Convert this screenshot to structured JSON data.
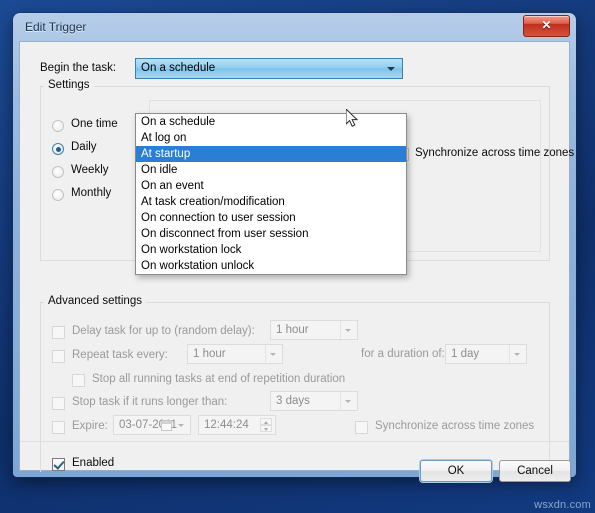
{
  "window": {
    "title": "Edit Trigger",
    "close_label": "✕"
  },
  "form": {
    "begin_label": "Begin the task:",
    "begin_value": "On a schedule"
  },
  "dropdown": {
    "selected": "At startup",
    "items": [
      "On a schedule",
      "At log on",
      "At startup",
      "On idle",
      "On an event",
      "At task creation/modification",
      "On connection to user session",
      "On disconnect from user session",
      "On workstation lock",
      "On workstation unlock"
    ]
  },
  "settings": {
    "legend": "Settings",
    "radios": [
      {
        "label": "One time",
        "checked": false
      },
      {
        "label": "Daily",
        "checked": true
      },
      {
        "label": "Weekly",
        "checked": false
      },
      {
        "label": "Monthly",
        "checked": false
      }
    ],
    "sync_label": "Synchronize across time zones",
    "sync_checked": false
  },
  "advanced": {
    "legend": "Advanced settings",
    "delay_label": "Delay task for up to (random delay):",
    "delay_checked": false,
    "delay_value": "1 hour",
    "repeat_label": "Repeat task every:",
    "repeat_checked": false,
    "repeat_value": "1 hour",
    "duration_label": "for a duration of:",
    "duration_value": "1 day",
    "stop_repetition_label": "Stop all running tasks at end of repetition duration",
    "stop_repetition_checked": false,
    "stop_task_label": "Stop task if it runs longer than:",
    "stop_task_checked": false,
    "stop_task_value": "3 days",
    "expire_label": "Expire:",
    "expire_checked": false,
    "expire_date": "03-07-2011",
    "expire_time": "12:44:24",
    "expire_sync_label": "Synchronize across time zones",
    "expire_sync_checked": false,
    "enabled_label": "Enabled",
    "enabled_checked": true
  },
  "footer": {
    "ok_label": "OK",
    "cancel_label": "Cancel"
  },
  "desktop": {
    "watermark": "wsxdn.com"
  },
  "colors": {
    "highlight": "#2a7fd4",
    "combo_border": "#3c7fb1",
    "close_red": "#c02e1c",
    "desktop_blue": "#14397a"
  }
}
